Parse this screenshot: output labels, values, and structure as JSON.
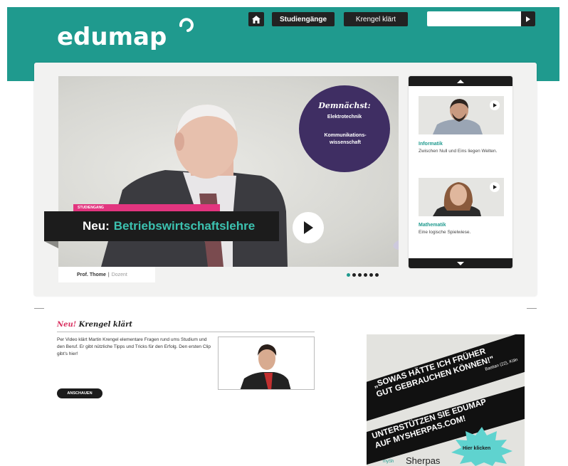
{
  "header": {
    "logo_text": "edumap",
    "nav": {
      "home_icon": "home-icon",
      "studiengaenge": "Studiengänge",
      "krengel": "Krengel klärt"
    },
    "search": {
      "placeholder": ""
    }
  },
  "hero": {
    "badge": {
      "title": "Demnächst:",
      "item1": "Elektrotechnik",
      "item2": "Kommunikations-wissenschaft"
    },
    "tag": "STUDIENGANG",
    "title_prefix": "Neu:",
    "title_subject": "Betriebswirtschaftslehre",
    "caption_name": "Prof. Thome",
    "caption_sep": "|",
    "caption_role": "Dozent",
    "slide_count": 6,
    "active_slide": 0
  },
  "side": {
    "items": [
      {
        "title": "Informatik",
        "desc": "Zwischen Null und Eins liegen Welten."
      },
      {
        "title": "Mathematik",
        "desc": "Eine logische Spielwiese."
      }
    ]
  },
  "krengel": {
    "neu": "Neu!",
    "title": "Krengel klärt",
    "text": "Per Video klärt Martin Krengel elementare Fragen rund ums Studium und den Beruf. Er gibt nützliche Tipps und Tricks für den Erfolg. Den ersten Clip gibt's hier!",
    "button": "ANSCHAUEN"
  },
  "ad": {
    "line1": "„SOWAS HÄTTE ICH FRÜHER",
    "line2": "GUT GEBRAUCHEN KÖNNEN!\"",
    "attribution": "Bastian (22), Köln",
    "line3": "UNTERSTÜTZEN SIE EDUMAP",
    "line4": "AUF MYSHERPAS.COM!",
    "cta": "Hier klicken",
    "brand": "Sherpas",
    "brand_prefix": "mySh"
  },
  "colors": {
    "brand": "#1f9a8e",
    "accent_pink": "#e2357f",
    "badge_purple": "#3f2e63"
  }
}
